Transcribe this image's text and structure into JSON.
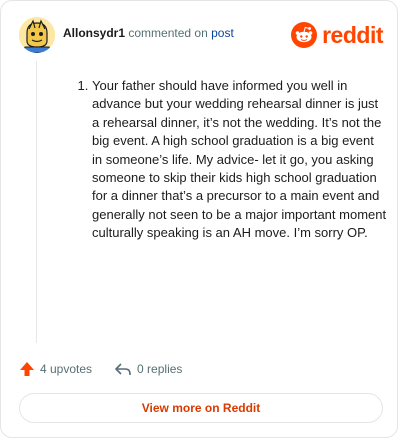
{
  "header": {
    "username": "Allonsydr1",
    "action_text": "commented on",
    "post_link": "post",
    "brand": "reddit"
  },
  "comment": {
    "list_number": 1,
    "text": "Your father should have informed you well in advance but your wedding rehearsal dinner is just a rehearsal dinner, it’s not the wedding. It’s not the big event. A high school graduation is a big event in someone’s life. My advice- let it go, you asking someone to skip their kids high school graduation for a dinner that’s a precursor to a main event and generally not seen to be a major important moment culturally speaking is an AH move. I’m sorry OP."
  },
  "actions": {
    "upvotes_label": "4 upvotes",
    "replies_label": "0 replies"
  },
  "footer": {
    "view_more_label": "View more on Reddit"
  },
  "colors": {
    "brand_orange": "#ff4500",
    "link_blue": "#0a449b",
    "view_more_text": "#d93a00"
  },
  "icons": {
    "upvote": "upvote-arrow-icon",
    "reply": "reply-arrow-icon",
    "logo": "reddit-snoo-icon"
  }
}
